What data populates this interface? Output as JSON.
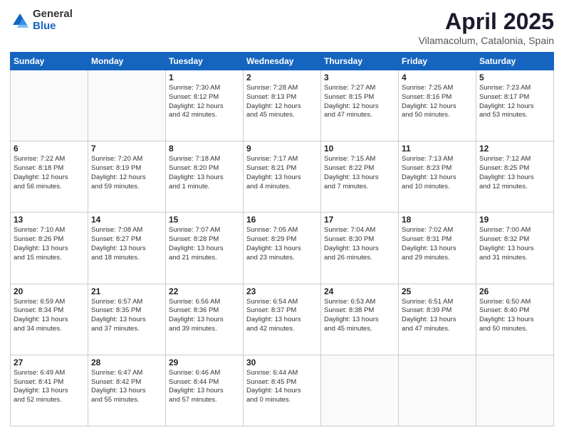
{
  "logo": {
    "general": "General",
    "blue": "Blue"
  },
  "header": {
    "title": "April 2025",
    "location": "Vilamacolum, Catalonia, Spain"
  },
  "weekdays": [
    "Sunday",
    "Monday",
    "Tuesday",
    "Wednesday",
    "Thursday",
    "Friday",
    "Saturday"
  ],
  "weeks": [
    [
      {
        "day": "",
        "text": ""
      },
      {
        "day": "",
        "text": ""
      },
      {
        "day": "1",
        "text": "Sunrise: 7:30 AM\nSunset: 8:12 PM\nDaylight: 12 hours\nand 42 minutes."
      },
      {
        "day": "2",
        "text": "Sunrise: 7:28 AM\nSunset: 8:13 PM\nDaylight: 12 hours\nand 45 minutes."
      },
      {
        "day": "3",
        "text": "Sunrise: 7:27 AM\nSunset: 8:15 PM\nDaylight: 12 hours\nand 47 minutes."
      },
      {
        "day": "4",
        "text": "Sunrise: 7:25 AM\nSunset: 8:16 PM\nDaylight: 12 hours\nand 50 minutes."
      },
      {
        "day": "5",
        "text": "Sunrise: 7:23 AM\nSunset: 8:17 PM\nDaylight: 12 hours\nand 53 minutes."
      }
    ],
    [
      {
        "day": "6",
        "text": "Sunrise: 7:22 AM\nSunset: 8:18 PM\nDaylight: 12 hours\nand 56 minutes."
      },
      {
        "day": "7",
        "text": "Sunrise: 7:20 AM\nSunset: 8:19 PM\nDaylight: 12 hours\nand 59 minutes."
      },
      {
        "day": "8",
        "text": "Sunrise: 7:18 AM\nSunset: 8:20 PM\nDaylight: 13 hours\nand 1 minute."
      },
      {
        "day": "9",
        "text": "Sunrise: 7:17 AM\nSunset: 8:21 PM\nDaylight: 13 hours\nand 4 minutes."
      },
      {
        "day": "10",
        "text": "Sunrise: 7:15 AM\nSunset: 8:22 PM\nDaylight: 13 hours\nand 7 minutes."
      },
      {
        "day": "11",
        "text": "Sunrise: 7:13 AM\nSunset: 8:23 PM\nDaylight: 13 hours\nand 10 minutes."
      },
      {
        "day": "12",
        "text": "Sunrise: 7:12 AM\nSunset: 8:25 PM\nDaylight: 13 hours\nand 12 minutes."
      }
    ],
    [
      {
        "day": "13",
        "text": "Sunrise: 7:10 AM\nSunset: 8:26 PM\nDaylight: 13 hours\nand 15 minutes."
      },
      {
        "day": "14",
        "text": "Sunrise: 7:08 AM\nSunset: 8:27 PM\nDaylight: 13 hours\nand 18 minutes."
      },
      {
        "day": "15",
        "text": "Sunrise: 7:07 AM\nSunset: 8:28 PM\nDaylight: 13 hours\nand 21 minutes."
      },
      {
        "day": "16",
        "text": "Sunrise: 7:05 AM\nSunset: 8:29 PM\nDaylight: 13 hours\nand 23 minutes."
      },
      {
        "day": "17",
        "text": "Sunrise: 7:04 AM\nSunset: 8:30 PM\nDaylight: 13 hours\nand 26 minutes."
      },
      {
        "day": "18",
        "text": "Sunrise: 7:02 AM\nSunset: 8:31 PM\nDaylight: 13 hours\nand 29 minutes."
      },
      {
        "day": "19",
        "text": "Sunrise: 7:00 AM\nSunset: 8:32 PM\nDaylight: 13 hours\nand 31 minutes."
      }
    ],
    [
      {
        "day": "20",
        "text": "Sunrise: 6:59 AM\nSunset: 8:34 PM\nDaylight: 13 hours\nand 34 minutes."
      },
      {
        "day": "21",
        "text": "Sunrise: 6:57 AM\nSunset: 8:35 PM\nDaylight: 13 hours\nand 37 minutes."
      },
      {
        "day": "22",
        "text": "Sunrise: 6:56 AM\nSunset: 8:36 PM\nDaylight: 13 hours\nand 39 minutes."
      },
      {
        "day": "23",
        "text": "Sunrise: 6:54 AM\nSunset: 8:37 PM\nDaylight: 13 hours\nand 42 minutes."
      },
      {
        "day": "24",
        "text": "Sunrise: 6:53 AM\nSunset: 8:38 PM\nDaylight: 13 hours\nand 45 minutes."
      },
      {
        "day": "25",
        "text": "Sunrise: 6:51 AM\nSunset: 8:39 PM\nDaylight: 13 hours\nand 47 minutes."
      },
      {
        "day": "26",
        "text": "Sunrise: 6:50 AM\nSunset: 8:40 PM\nDaylight: 13 hours\nand 50 minutes."
      }
    ],
    [
      {
        "day": "27",
        "text": "Sunrise: 6:49 AM\nSunset: 8:41 PM\nDaylight: 13 hours\nand 52 minutes."
      },
      {
        "day": "28",
        "text": "Sunrise: 6:47 AM\nSunset: 8:42 PM\nDaylight: 13 hours\nand 55 minutes."
      },
      {
        "day": "29",
        "text": "Sunrise: 6:46 AM\nSunset: 8:44 PM\nDaylight: 13 hours\nand 57 minutes."
      },
      {
        "day": "30",
        "text": "Sunrise: 6:44 AM\nSunset: 8:45 PM\nDaylight: 14 hours\nand 0 minutes."
      },
      {
        "day": "",
        "text": ""
      },
      {
        "day": "",
        "text": ""
      },
      {
        "day": "",
        "text": ""
      }
    ]
  ]
}
